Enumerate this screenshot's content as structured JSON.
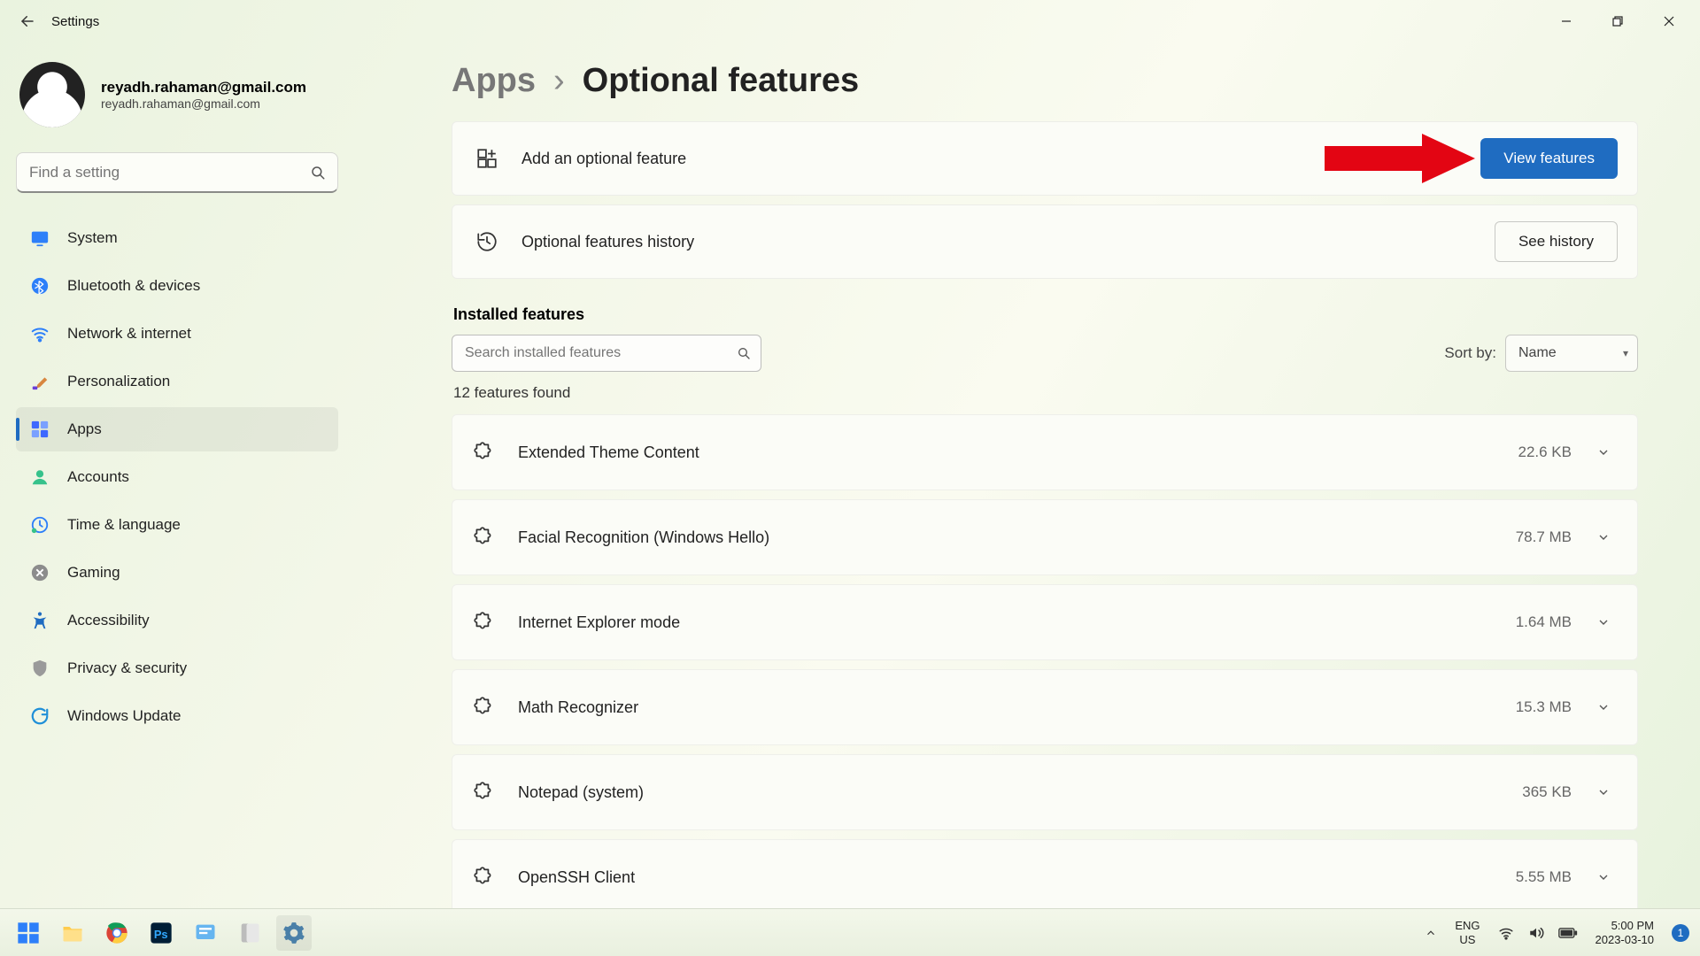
{
  "titlebar": {
    "app_title": "Settings"
  },
  "profile": {
    "display_name": "reyadh.rahaman@gmail.com",
    "email": "reyadh.rahaman@gmail.com"
  },
  "sidebar": {
    "search_placeholder": "Find a setting",
    "items": [
      {
        "label": "System"
      },
      {
        "label": "Bluetooth & devices"
      },
      {
        "label": "Network & internet"
      },
      {
        "label": "Personalization"
      },
      {
        "label": "Apps"
      },
      {
        "label": "Accounts"
      },
      {
        "label": "Time & language"
      },
      {
        "label": "Gaming"
      },
      {
        "label": "Accessibility"
      },
      {
        "label": "Privacy & security"
      },
      {
        "label": "Windows Update"
      }
    ],
    "active_index": 4
  },
  "breadcrumb": {
    "parent": "Apps",
    "current": "Optional features"
  },
  "cards": {
    "add": {
      "label": "Add an optional feature",
      "button": "View features"
    },
    "history": {
      "label": "Optional features history",
      "button": "See history"
    }
  },
  "installed": {
    "section_title": "Installed features",
    "search_placeholder": "Search installed features",
    "sort_label": "Sort by:",
    "sort_value": "Name",
    "count_text": "12 features found",
    "features": [
      {
        "name": "Extended Theme Content",
        "size": "22.6 KB"
      },
      {
        "name": "Facial Recognition (Windows Hello)",
        "size": "78.7 MB"
      },
      {
        "name": "Internet Explorer mode",
        "size": "1.64 MB"
      },
      {
        "name": "Math Recognizer",
        "size": "15.3 MB"
      },
      {
        "name": "Notepad (system)",
        "size": "365 KB"
      },
      {
        "name": "OpenSSH Client",
        "size": "5.55 MB"
      }
    ]
  },
  "taskbar": {
    "lang_top": "ENG",
    "lang_bot": "US",
    "time": "5:00 PM",
    "date": "2023-03-10",
    "notif_count": "1"
  }
}
